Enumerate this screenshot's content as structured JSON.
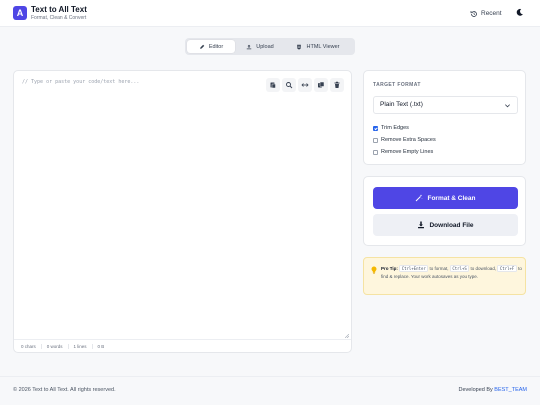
{
  "header": {
    "logo_letter": "A",
    "title": "Text to All Text",
    "subtitle": "Format, Clean & Convert",
    "recent_label": "Recent"
  },
  "tabs": [
    {
      "label": "Editor",
      "active": true,
      "icon": "pen-icon"
    },
    {
      "label": "Upload",
      "active": false,
      "icon": "upload-icon"
    },
    {
      "label": "HTML Viewer",
      "active": false,
      "icon": "html-icon"
    }
  ],
  "editor": {
    "placeholder": "// Type or paste your code/text here...",
    "value": "",
    "toolbar": [
      "paste-icon",
      "search-icon",
      "swap-icon",
      "copy-icon",
      "trash-icon"
    ],
    "status": {
      "chars": "0 chars",
      "words": "0 words",
      "lines": "1 lines",
      "size": "0 B"
    }
  },
  "format": {
    "heading": "TARGET FORMAT",
    "selected": "Plain Text (.txt)",
    "options": [
      {
        "label": "Trim Edges",
        "checked": true
      },
      {
        "label": "Remove Extra Spaces",
        "checked": false
      },
      {
        "label": "Remove Empty Lines",
        "checked": false
      }
    ]
  },
  "actions": {
    "format_label": "Format & Clean",
    "download_label": "Download File"
  },
  "tip": {
    "title": "Pro Tip:",
    "key1": "Ctrl+Enter",
    "text1": "to format,",
    "key2": "Ctrl+S",
    "text2": "to download,",
    "key3": "Ctrl+F",
    "text3": "to find & replace. Your work autosaves as you type."
  },
  "footer": {
    "copyright": "© 2026 Text to All Text. All rights reserved.",
    "developed_by": "Developed By",
    "brand": "BEST_TEAM"
  },
  "colors": {
    "accent": "#4f46e5",
    "checkbox": "#2563eb",
    "tip_bg": "#fef6dd"
  }
}
